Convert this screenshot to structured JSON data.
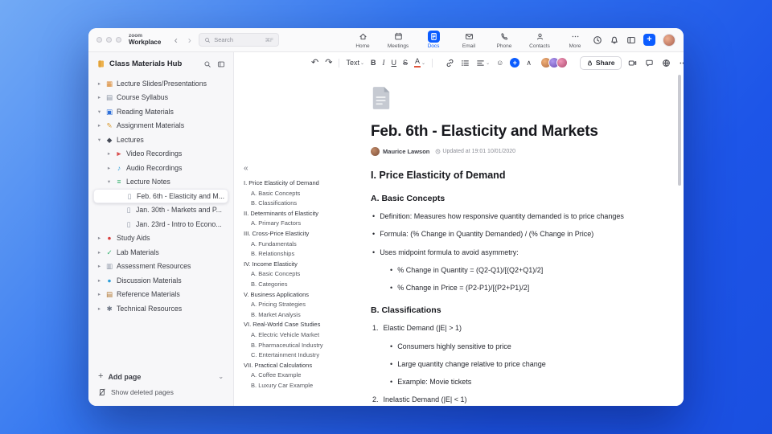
{
  "colors": {
    "accent": "#0b5cff"
  },
  "titlebar": {
    "brand": {
      "line1": "zoom",
      "line2": "Workplace"
    },
    "search": {
      "placeholder": "Search",
      "shortcut": "⌘F"
    },
    "nav": [
      {
        "label": "Home",
        "icon": "home-icon",
        "active": false
      },
      {
        "label": "Meetings",
        "icon": "meetings-icon",
        "active": false
      },
      {
        "label": "Docs",
        "icon": "docs-icon",
        "active": true
      },
      {
        "label": "Email",
        "icon": "email-icon",
        "active": false
      },
      {
        "label": "Phone",
        "icon": "phone-icon",
        "active": false
      },
      {
        "label": "Contacts",
        "icon": "contacts-icon",
        "active": false
      },
      {
        "label": "More",
        "icon": "more-dots-icon",
        "active": false
      }
    ],
    "actions": [
      {
        "name": "recent-activity-button",
        "icon": "clock-icon"
      },
      {
        "name": "notifications-button",
        "icon": "bell-icon"
      },
      {
        "name": "panel-toggle-button",
        "icon": "panel-icon"
      }
    ]
  },
  "sidebar": {
    "title": "Class Materials Hub",
    "items": [
      {
        "label": "Lecture Slides/Presentations",
        "icon": "presentation-icon",
        "glyph": "▦",
        "color": "#d9862e",
        "level": 0,
        "chevron": "right",
        "selected": false
      },
      {
        "label": "Course Syllabus",
        "icon": "syllabus-icon",
        "glyph": "▤",
        "color": "#8a93a2",
        "level": 0,
        "chevron": "right",
        "selected": false
      },
      {
        "label": "Reading Materials",
        "icon": "book-icon",
        "glyph": "▣",
        "color": "#2e6fd9",
        "level": 0,
        "chevron": "down",
        "selected": false
      },
      {
        "label": "Assignment Materials",
        "icon": "pencil-icon",
        "glyph": "✎",
        "color": "#d99a2e",
        "level": 0,
        "chevron": "right",
        "selected": false
      },
      {
        "label": "Lectures",
        "icon": "graduation-cap-icon",
        "glyph": "◆",
        "color": "#454a56",
        "level": 0,
        "chevron": "down",
        "selected": false
      },
      {
        "label": "Video Recordings",
        "icon": "video-icon",
        "glyph": "►",
        "color": "#d94f4f",
        "level": 1,
        "chevron": "right",
        "selected": false
      },
      {
        "label": "Audio Recordings",
        "icon": "audio-icon",
        "glyph": "♪",
        "color": "#2e9fd9",
        "level": 1,
        "chevron": "right",
        "selected": false
      },
      {
        "label": "Lecture Notes",
        "icon": "notes-icon",
        "glyph": "≡",
        "color": "#2eb06a",
        "level": 1,
        "chevron": "down",
        "selected": false
      },
      {
        "label": "Feb. 6th - Elasticity and M...",
        "icon": "page-icon",
        "glyph": "▯",
        "color": "#8a93a2",
        "level": 2,
        "chevron": "none",
        "selected": true
      },
      {
        "label": "Jan. 30th - Markets and P...",
        "icon": "page-icon",
        "glyph": "▯",
        "color": "#8a93a2",
        "level": 2,
        "chevron": "none",
        "selected": false
      },
      {
        "label": "Jan. 23rd - Intro to Econo...",
        "icon": "page-icon",
        "glyph": "▯",
        "color": "#8a93a2",
        "level": 2,
        "chevron": "none",
        "selected": false
      },
      {
        "label": "Study Aids",
        "icon": "apple-icon",
        "glyph": "●",
        "color": "#d93f3f",
        "level": 0,
        "chevron": "right",
        "selected": false
      },
      {
        "label": "Lab Materials",
        "icon": "check-icon",
        "glyph": "✓",
        "color": "#2eb06a",
        "level": 0,
        "chevron": "right",
        "selected": false
      },
      {
        "label": "Assessment Resources",
        "icon": "clipboard-icon",
        "glyph": "▥",
        "color": "#8a93a2",
        "level": 0,
        "chevron": "right",
        "selected": false
      },
      {
        "label": "Discussion Materials",
        "icon": "chat-bubble-icon",
        "glyph": "●",
        "color": "#2e9fd9",
        "level": 0,
        "chevron": "right",
        "selected": false
      },
      {
        "label": "Reference Materials",
        "icon": "books-icon",
        "glyph": "▤",
        "color": "#b0762e",
        "level": 0,
        "chevron": "right",
        "selected": false
      },
      {
        "label": "Technical Resources",
        "icon": "tools-icon",
        "glyph": "✱",
        "color": "#6a7382",
        "level": 0,
        "chevron": "right",
        "selected": false
      }
    ],
    "footer": {
      "add_page": "Add page",
      "show_deleted": "Show deleted pages"
    }
  },
  "toolbar": {
    "share_label": "Share",
    "buttons": [
      {
        "name": "undo-button",
        "glyph": "↶",
        "cls": "arrow"
      },
      {
        "name": "redo-button",
        "glyph": "↷",
        "cls": "arrow"
      },
      {
        "name": "divider-1",
        "divider": true
      },
      {
        "name": "text-style-dropdown",
        "glyph": "Text",
        "dropdown": true
      },
      {
        "name": "bold-button",
        "glyph": "B",
        "cls": "b"
      },
      {
        "name": "italic-button",
        "glyph": "I",
        "cls": "i"
      },
      {
        "name": "underline-button",
        "glyph": "U",
        "cls": "u"
      },
      {
        "name": "strikethrough-button",
        "glyph": "S",
        "cls": "s"
      },
      {
        "name": "text-color-button",
        "glyph": "A",
        "cls": "color",
        "dropdown": true
      },
      {
        "name": "divider-2",
        "divider": true
      },
      {
        "name": "code-button",
        "glyph": "</>",
        "cls": "code"
      },
      {
        "name": "link-button",
        "svg": "link-icon"
      },
      {
        "name": "bullet-list-button",
        "svg": "list-icon"
      },
      {
        "name": "align-button",
        "svg": "align-icon",
        "dropdown": true
      },
      {
        "name": "emoji-button",
        "glyph": "☺"
      },
      {
        "name": "insert-button",
        "glyph": "+",
        "cls": "insert"
      },
      {
        "name": "collapse-toolbar-button",
        "glyph": "∧"
      }
    ],
    "avatars": [
      {
        "name": "collaborator-avatar",
        "color1": "#f0b078",
        "color2": "#b06a40"
      },
      {
        "name": "collaborator-avatar",
        "color1": "#b09af0",
        "color2": "#6a4ab0"
      },
      {
        "name": "collaborator-avatar",
        "color1": "#f098b8",
        "color2": "#b04a70"
      }
    ],
    "right_actions": [
      {
        "name": "start-video-button",
        "icon": "camera-icon"
      },
      {
        "name": "comments-button",
        "icon": "comment-icon"
      },
      {
        "name": "language-button",
        "icon": "globe-icon"
      },
      {
        "name": "more-options-button",
        "icon": "more-h-icon"
      }
    ]
  },
  "outline": {
    "collapse_glyph": "«",
    "items": [
      {
        "text": "I. Price Elasticity of Demand",
        "sub": false
      },
      {
        "text": "A. Basic Concepts",
        "sub": true
      },
      {
        "text": "B. Classifications",
        "sub": true
      },
      {
        "text": "II. Determinants of Elasticity",
        "sub": false
      },
      {
        "text": "A. Primary Factors",
        "sub": true
      },
      {
        "text": "III. Cross-Price Elasticity",
        "sub": false
      },
      {
        "text": "A. Fundamentals",
        "sub": true
      },
      {
        "text": "B. Relationships",
        "sub": true
      },
      {
        "text": "IV. Income Elasticity",
        "sub": false
      },
      {
        "text": "A. Basic Concepts",
        "sub": true
      },
      {
        "text": "B. Categories",
        "sub": true
      },
      {
        "text": "V. Business Applications",
        "sub": false
      },
      {
        "text": "A. Pricing Strategies",
        "sub": true
      },
      {
        "text": "B. Market Analysis",
        "sub": true
      },
      {
        "text": "VI. Real-World Case Studies",
        "sub": false
      },
      {
        "text": "A. Electric Vehicle Market",
        "sub": true
      },
      {
        "text": "B. Pharmaceutical Industry",
        "sub": true
      },
      {
        "text": "C. Entertainment Industry",
        "sub": true
      },
      {
        "text": "VII. Practical Calculations",
        "sub": false
      },
      {
        "text": "A. Coffee Example",
        "sub": true
      },
      {
        "text": "B. Luxury Car Example",
        "sub": true
      }
    ]
  },
  "document": {
    "title": "Feb. 6th - Elasticity and Markets",
    "author": "Maurice Lawson",
    "updated": "Updated at 19:01 10/01/2020",
    "blocks": [
      {
        "type": "h2",
        "text": "I. Price Elasticity of Demand"
      },
      {
        "type": "h3",
        "text": "A. Basic Concepts"
      },
      {
        "type": "bullet",
        "level": 1,
        "text": "Definition: Measures how responsive quantity demanded is to price changes"
      },
      {
        "type": "bullet",
        "level": 1,
        "text": "Formula: (% Change in Quantity Demanded) / (% Change in Price)"
      },
      {
        "type": "bullet",
        "level": 1,
        "text": "Uses midpoint formula to avoid asymmetry:"
      },
      {
        "type": "bullet",
        "level": 2,
        "text": "% Change in Quantity = (Q2-Q1)/[(Q2+Q1)/2]"
      },
      {
        "type": "bullet",
        "level": 2,
        "text": "% Change in Price = (P2-P1)/[(P2+P1)/2]"
      },
      {
        "type": "h3",
        "text": "B. Classifications"
      },
      {
        "type": "number",
        "num": "1.",
        "text": "Elastic Demand (|E| > 1)"
      },
      {
        "type": "bullet",
        "level": 2,
        "text": "Consumers highly sensitive to price"
      },
      {
        "type": "bullet",
        "level": 2,
        "text": "Large quantity change relative to price change"
      },
      {
        "type": "bullet",
        "level": 2,
        "text": "Example: Movie tickets"
      },
      {
        "type": "number",
        "num": "2.",
        "text": "Inelastic Demand (|E| < 1)"
      }
    ]
  }
}
